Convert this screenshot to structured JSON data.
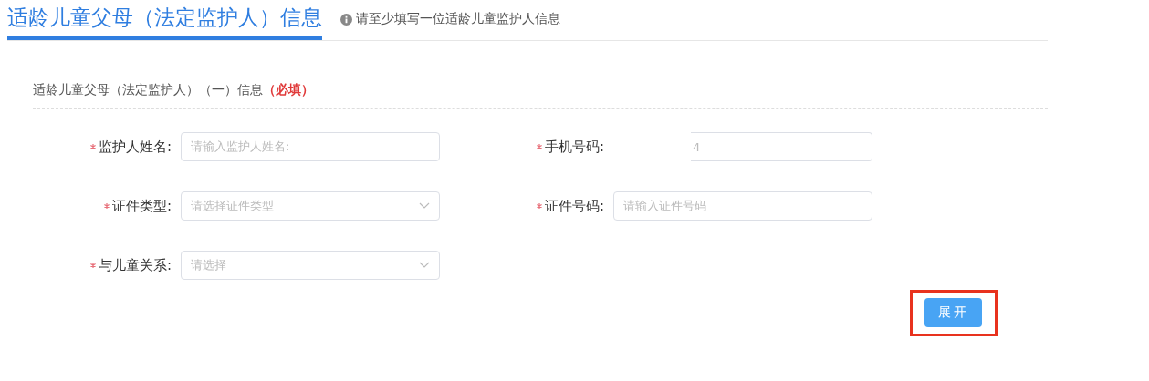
{
  "header": {
    "title": "适龄儿童父母（法定监护人）信息",
    "notice": "请至少填写一位适龄儿童监护人信息"
  },
  "section": {
    "title": "适龄儿童父母（法定监护人）（一）信息",
    "required_note": "（必填）"
  },
  "fields": [
    {
      "kind": "input",
      "label": "监护人姓名:",
      "required": true,
      "placeholder": "请输入监护人姓名:"
    },
    {
      "kind": "input",
      "label": "手机号码:",
      "required": true,
      "value": "4"
    },
    {
      "kind": "select",
      "label": "证件类型:",
      "required": true,
      "placeholder": "请选择证件类型"
    },
    {
      "kind": "input",
      "label": "证件号码:",
      "required": true,
      "placeholder": "请输入证件号码"
    },
    {
      "kind": "select",
      "label": "与儿童关系:",
      "required": true,
      "placeholder": "请选择"
    }
  ],
  "expand_button": {
    "label": "展开",
    "highlighted": true
  }
}
